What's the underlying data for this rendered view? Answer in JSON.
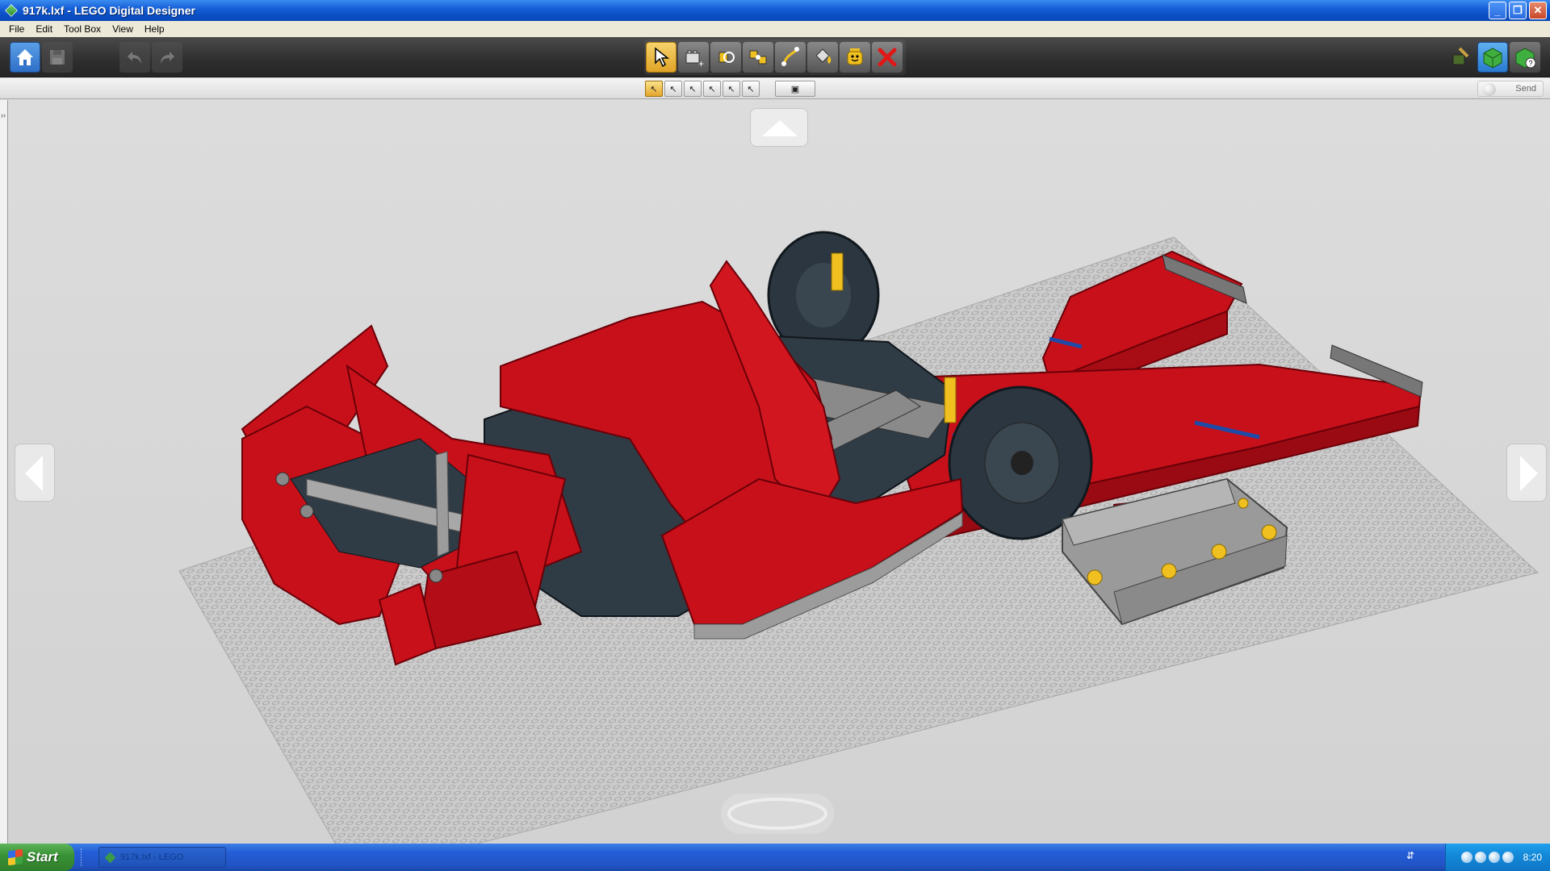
{
  "window": {
    "title": "917k.lxf - LEGO Digital Designer",
    "controls": {
      "minimize": "_",
      "maximize": "❐",
      "close": "✕"
    }
  },
  "menu": {
    "items": [
      "File",
      "Edit",
      "Tool Box",
      "View",
      "Help"
    ]
  },
  "toolbar": {
    "left_buttons": [
      {
        "name": "home",
        "icon": "house-icon"
      },
      {
        "name": "save",
        "icon": "floppy-icon"
      },
      {
        "name": "undo",
        "icon": "undo-arrow-icon"
      },
      {
        "name": "redo",
        "icon": "redo-arrow-icon"
      }
    ],
    "tools": [
      {
        "name": "select",
        "icon": "arrow-cursor-icon",
        "active": true
      },
      {
        "name": "clone",
        "icon": "brick-clone-icon"
      },
      {
        "name": "hinge",
        "icon": "hinge-icon"
      },
      {
        "name": "hinge-align",
        "icon": "hinge-align-icon"
      },
      {
        "name": "flex",
        "icon": "flex-icon"
      },
      {
        "name": "paint",
        "icon": "paint-bucket-icon"
      },
      {
        "name": "decorate",
        "icon": "minifig-face-icon"
      },
      {
        "name": "delete",
        "icon": "red-x-icon"
      }
    ],
    "right_buttons": [
      {
        "name": "build-mode",
        "icon": "build-mode-icon"
      },
      {
        "name": "view-mode",
        "icon": "view-mode-icon"
      },
      {
        "name": "building-guide-mode",
        "icon": "building-guide-icon"
      }
    ]
  },
  "subtoolbar": {
    "select_modes": [
      "single-select",
      "multi-select",
      "connected-select",
      "same-color-select",
      "same-brick-select",
      "invert-select"
    ],
    "extra": "hide-tool",
    "send_label": "Send"
  },
  "canvas": {
    "model_name": "917k",
    "nav_arrows": [
      "up",
      "left",
      "right",
      "down"
    ],
    "colors": {
      "background": "#d6d6d6",
      "baseplate": "#c8c8c8",
      "red_parts": "#c8101a",
      "dark_parts": "#2e3a44",
      "gray_parts": "#8a8a8a",
      "yellow_parts": "#f0c020"
    }
  },
  "taskbar": {
    "start_label": "Start",
    "task_label": "917k.lxf - LEGO",
    "clock": "8:20"
  }
}
